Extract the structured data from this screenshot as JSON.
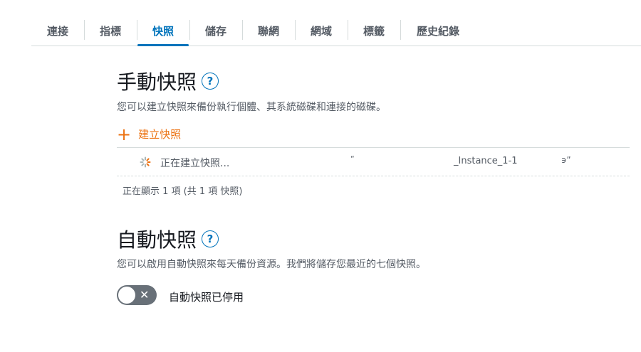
{
  "tabs": [
    {
      "label": "連接",
      "active": false
    },
    {
      "label": "指標",
      "active": false
    },
    {
      "label": "快照",
      "active": true
    },
    {
      "label": "儲存",
      "active": false
    },
    {
      "label": "聯網",
      "active": false
    },
    {
      "label": "網域",
      "active": false
    },
    {
      "label": "標籤",
      "active": false
    },
    {
      "label": "歷史紀錄",
      "active": false
    }
  ],
  "manual": {
    "title": "手動快照",
    "help": "?",
    "description": "您可以建立快照來備份執行個體、其系統磁碟和連接的磁碟。",
    "create_label": "建立快照",
    "row": {
      "status": "正在建立快照...",
      "quote_open": "“",
      "name": "_Instance_1-1",
      "quote_close": "϶”"
    },
    "count_text": "正在顯示 1 項 (共 1 項 快照)"
  },
  "auto": {
    "title": "自動快照",
    "help": "?",
    "description": "您可以啟用自動快照來每天備份資源。我們將儲存您最近的七個快照。",
    "toggle_state": "off",
    "toggle_label": "自動快照已停用"
  },
  "colors": {
    "accent": "#0073bb",
    "orange": "#ec7211",
    "toggle_off": "#687078"
  }
}
